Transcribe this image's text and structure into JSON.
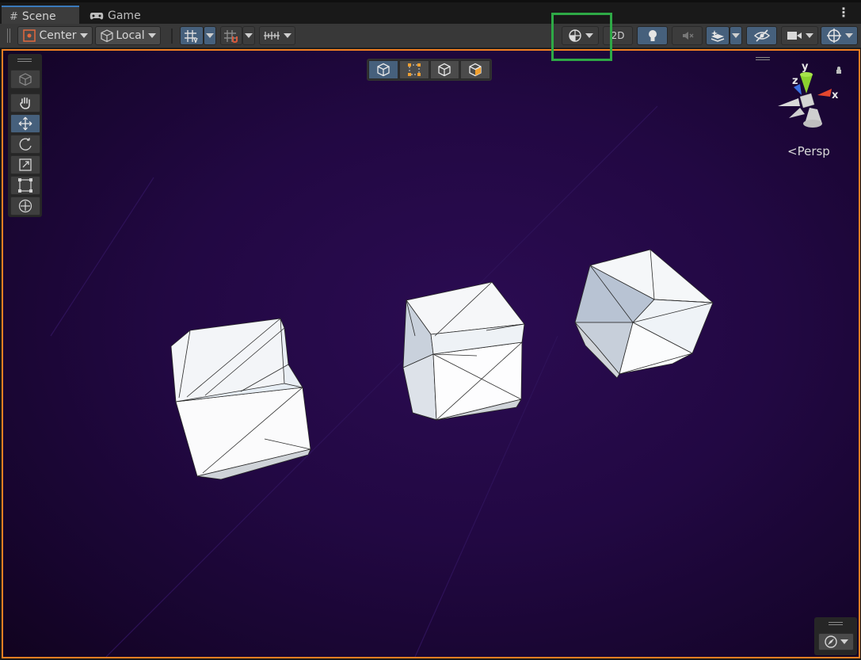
{
  "tabs": [
    {
      "label": "Scene",
      "icon": "grid-icon",
      "active": true
    },
    {
      "label": "Game",
      "icon": "gamepad-icon",
      "active": false
    }
  ],
  "toolbar": {
    "pivot_label": "Center",
    "space_label": "Local",
    "twod_label": "2D"
  },
  "gizmo": {
    "axis_y": "y",
    "axis_z": "z",
    "axis_x": "x",
    "projection_label": "Persp"
  },
  "colors": {
    "accent_blue": "#46607c",
    "viewport_border": "#f07f23",
    "highlight": "#2ea946",
    "axis_x": "#e4462e",
    "axis_y": "#8bd12f",
    "axis_z": "#3a6fe0"
  },
  "scene": {
    "objects": [
      "cube-1",
      "cube-2",
      "cube-3"
    ]
  }
}
